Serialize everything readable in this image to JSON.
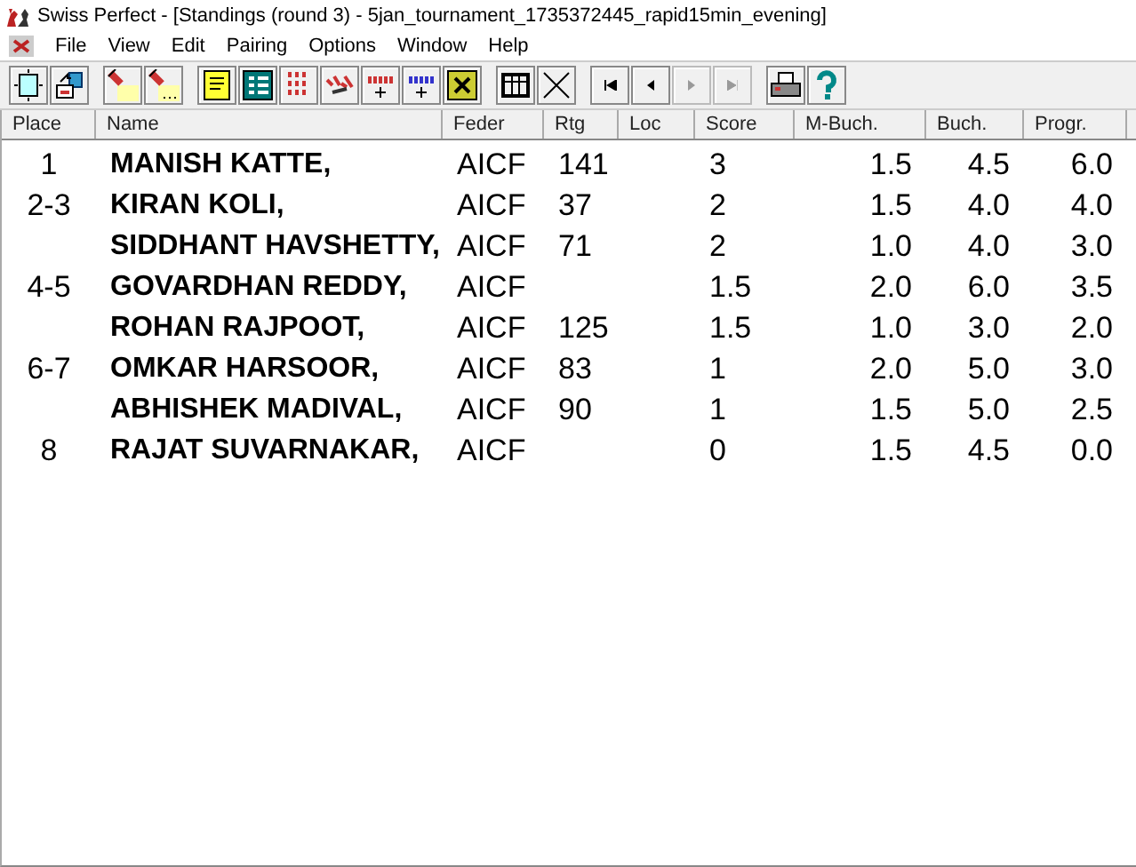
{
  "window": {
    "title": "Swiss Perfect - [Standings  (round 3) - 5jan_tournament_1735372445_rapid15min_evening]"
  },
  "menu": [
    "File",
    "View",
    "Edit",
    "Pairing",
    "Options",
    "Window",
    "Help"
  ],
  "toolbar": [
    [
      {
        "kind": "new",
        "disabled": false
      },
      {
        "kind": "export",
        "disabled": false
      }
    ],
    [
      {
        "kind": "torch",
        "disabled": false
      },
      {
        "kind": "torch-dots",
        "disabled": false
      }
    ],
    [
      {
        "kind": "sheet",
        "disabled": false
      },
      {
        "kind": "list",
        "disabled": false
      },
      {
        "kind": "grid",
        "disabled": false
      },
      {
        "kind": "scatter",
        "disabled": false
      },
      {
        "kind": "red-digits",
        "disabled": false
      },
      {
        "kind": "blue-digits",
        "disabled": false
      },
      {
        "kind": "cross-box",
        "disabled": false
      }
    ],
    [
      {
        "kind": "table",
        "disabled": false
      },
      {
        "kind": "cross",
        "disabled": false
      }
    ],
    [
      {
        "kind": "first",
        "disabled": false
      },
      {
        "kind": "prev",
        "disabled": false
      },
      {
        "kind": "next",
        "disabled": true
      },
      {
        "kind": "last",
        "disabled": true
      }
    ],
    [
      {
        "kind": "printer",
        "disabled": false
      },
      {
        "kind": "help",
        "disabled": false
      }
    ]
  ],
  "table": {
    "columns": [
      "Place",
      "Name",
      "Feder",
      "Rtg",
      "Loc",
      "Score",
      "M-Buch.",
      "Buch.",
      "Progr."
    ],
    "rows": [
      [
        "1",
        "MANISH KATTE,",
        "AICF",
        "141",
        "",
        "3",
        "1.5",
        "4.5",
        "6.0"
      ],
      [
        "2-3",
        "KIRAN KOLI,",
        "AICF",
        "37",
        "",
        "2",
        "1.5",
        "4.0",
        "4.0"
      ],
      [
        "",
        "SIDDHANT HAVSHETTY,",
        "AICF",
        "71",
        "",
        "2",
        "1.0",
        "4.0",
        "3.0"
      ],
      [
        "4-5",
        "GOVARDHAN REDDY,",
        "AICF",
        "",
        "",
        "1.5",
        "2.0",
        "6.0",
        "3.5"
      ],
      [
        "",
        "ROHAN RAJPOOT,",
        "AICF",
        "125",
        "",
        "1.5",
        "1.0",
        "3.0",
        "2.0"
      ],
      [
        "6-7",
        "OMKAR HARSOOR,",
        "AICF",
        "83",
        "",
        "1",
        "2.0",
        "5.0",
        "3.0"
      ],
      [
        "",
        "ABHISHEK MADIVAL,",
        "AICF",
        "90",
        "",
        "1",
        "1.5",
        "5.0",
        "2.5"
      ],
      [
        "8",
        "RAJAT SUVARNAKAR,",
        "AICF",
        "",
        "",
        "0",
        "1.5",
        "4.5",
        "0.0"
      ]
    ]
  }
}
